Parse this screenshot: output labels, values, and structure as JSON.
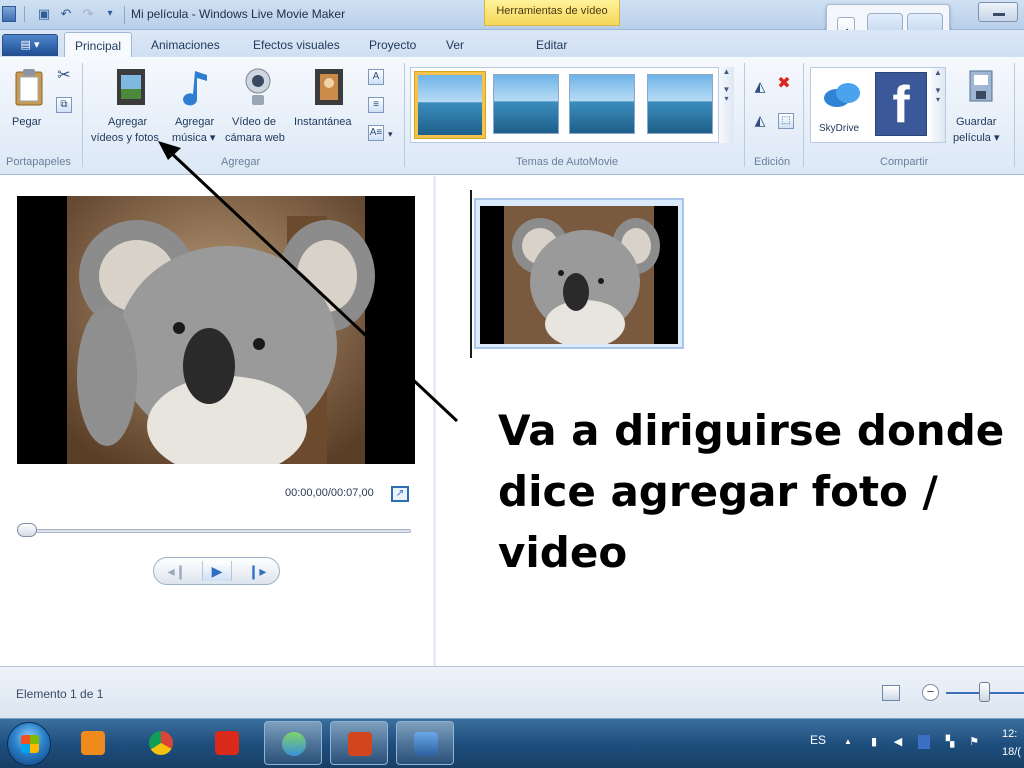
{
  "window": {
    "title": "Mi película - Windows Live Movie Maker",
    "context_tab_header": "Herramientas de vídeo"
  },
  "tabs": [
    {
      "label": "Principal",
      "active": true
    },
    {
      "label": "Animaciones"
    },
    {
      "label": "Efectos visuales"
    },
    {
      "label": "Proyecto"
    },
    {
      "label": "Ver"
    },
    {
      "label": "Editar"
    }
  ],
  "ribbon": {
    "clipboard": {
      "paste_label": "Pegar",
      "group_label": "Portapapeles"
    },
    "add": {
      "add_videos_photos_line1": "Agregar",
      "add_videos_photos_line2": "vídeos y fotos",
      "add_music_line1": "Agregar",
      "add_music_line2": "música ▾",
      "webcam_video_line1": "Vídeo de",
      "webcam_video_line2": "cámara web",
      "snapshot_label": "Instantánea",
      "group_label": "Agregar"
    },
    "automovie": {
      "group_label": "Temas de AutoMovie"
    },
    "editing": {
      "group_label": "Edición"
    },
    "share": {
      "skydrive_label": "SkyDrive",
      "save_movie_line1": "Guardar",
      "save_movie_line2": "película ▾",
      "group_label": "Compartir"
    }
  },
  "preview": {
    "time_readout": "00:00,00/00:07,00"
  },
  "annotation": {
    "text": "Va a diriguirse donde dice agregar  foto / video"
  },
  "status": {
    "item_count": "Elemento 1 de 1"
  },
  "taskbar": {
    "language": "ES",
    "clock_time": "12:",
    "clock_date": "18/("
  },
  "colors": {
    "ribbon_accent": "#1e395b",
    "selected_theme_border": "#f3c34b",
    "taskbar": "#1f4f7e",
    "facebook": "#3b5998"
  }
}
